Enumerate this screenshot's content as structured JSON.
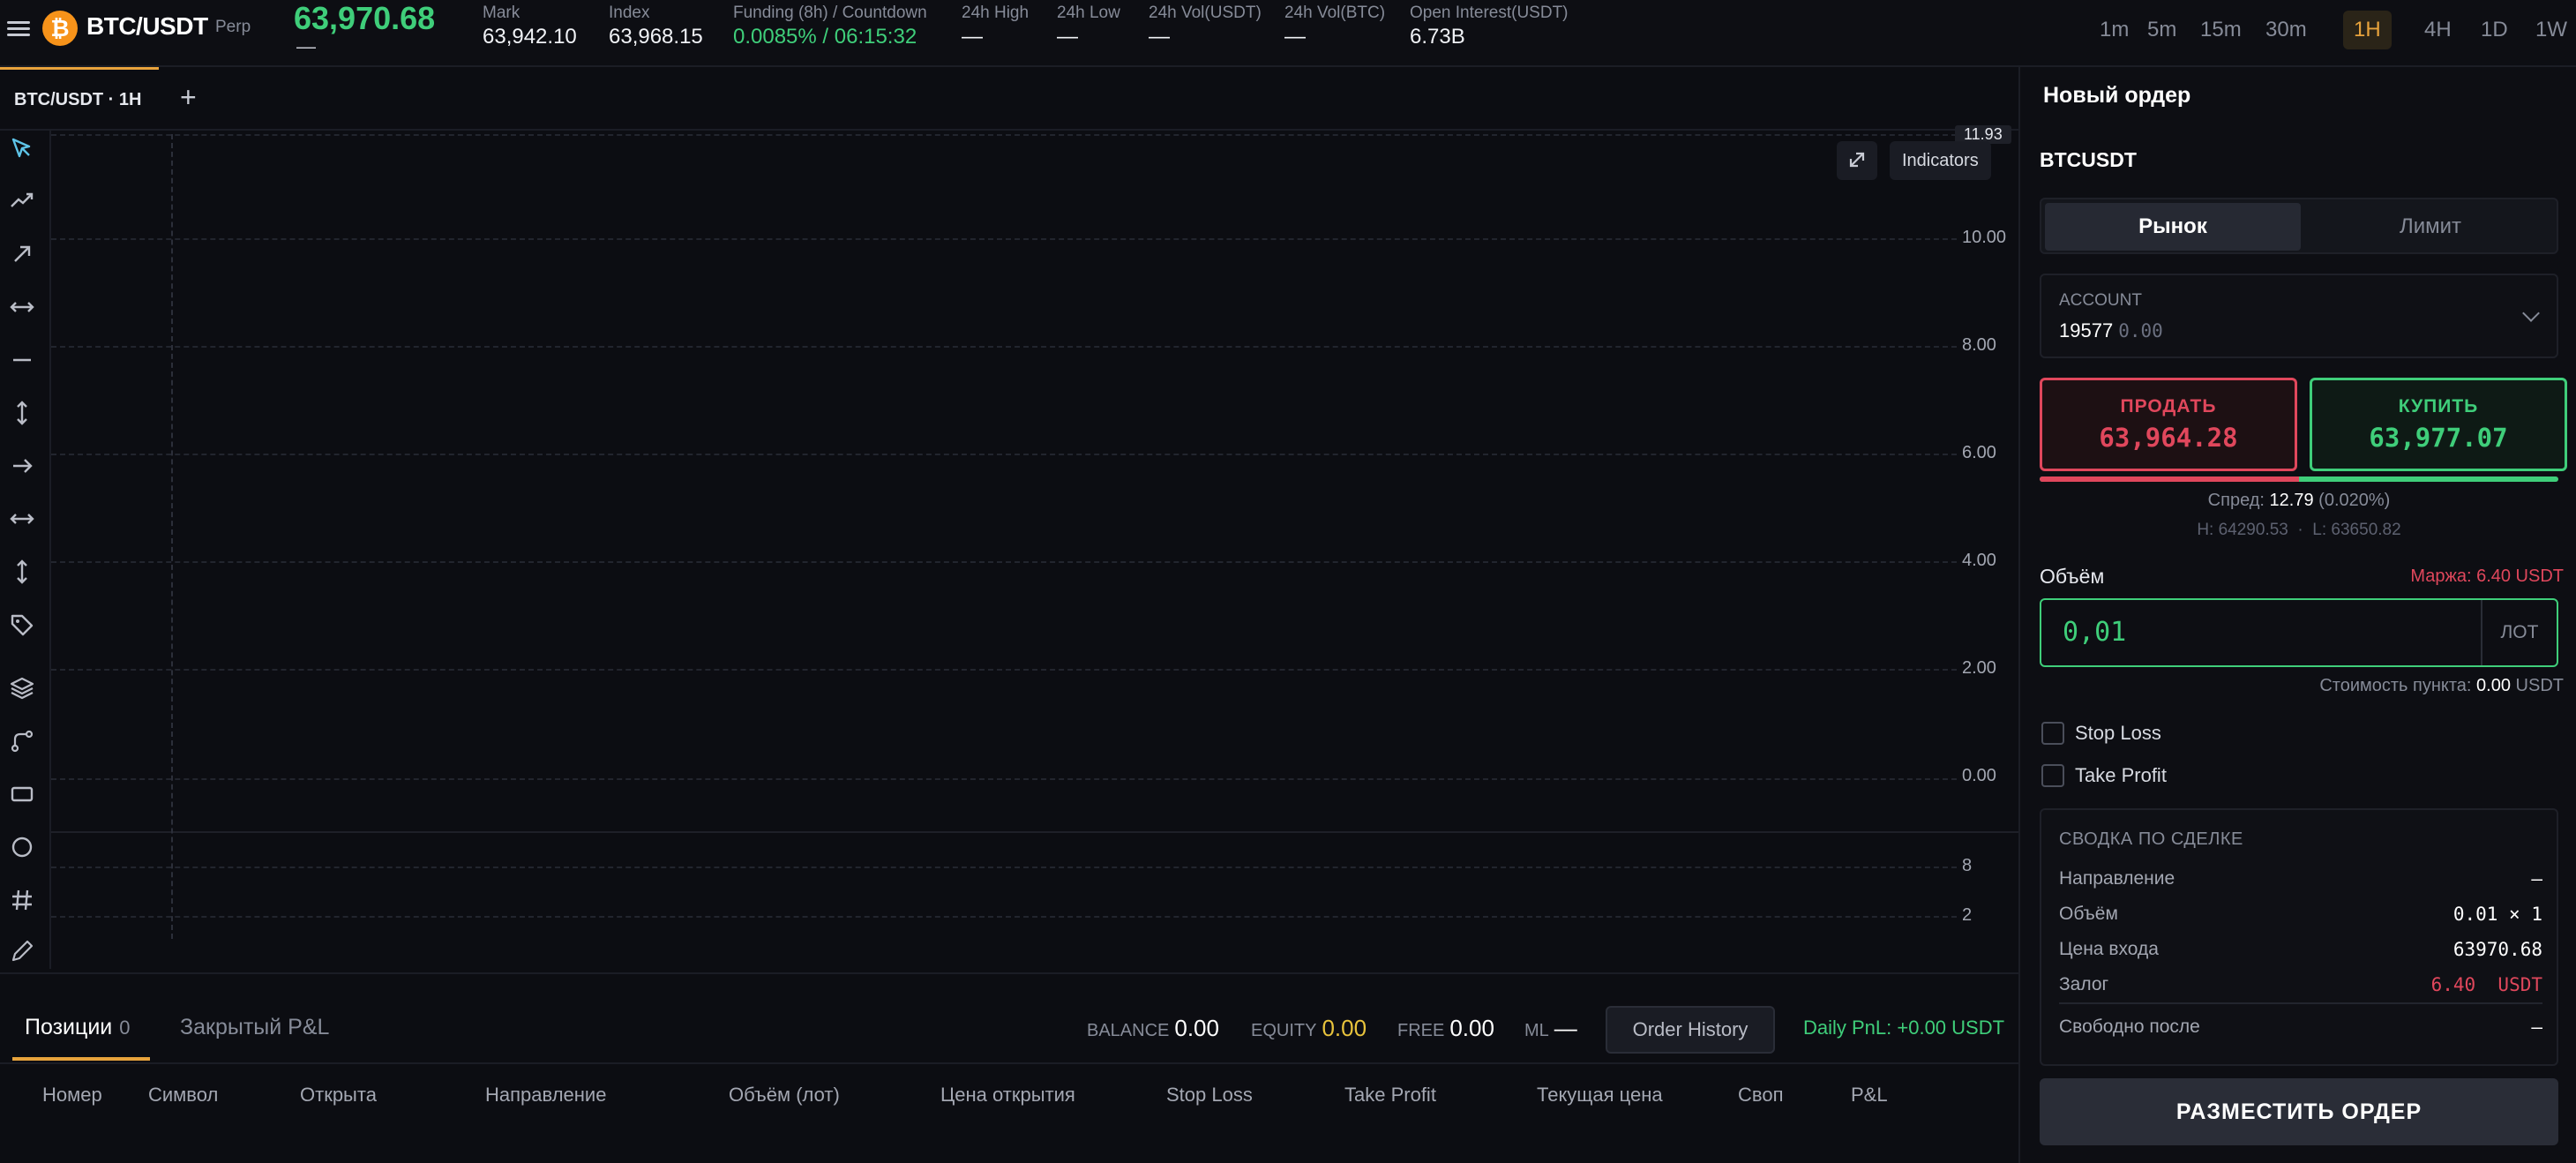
{
  "header": {
    "symbol": "BTC/USDT",
    "logo_letter": "₿",
    "contract": "Perp",
    "last_price": "63,970.68",
    "last_change": "—",
    "stats": [
      {
        "label": "Mark",
        "value": "63,942.10"
      },
      {
        "label": "Index",
        "value": "63,968.15"
      },
      {
        "label": "Funding (8h) / Countdown",
        "value": "0.0085% / 06:15:32"
      },
      {
        "label": "24h High",
        "value": "—"
      },
      {
        "label": "24h Low",
        "value": "—"
      },
      {
        "label": "24h Vol(USDT)",
        "value": "—"
      },
      {
        "label": "24h Vol(BTC)",
        "value": "—"
      },
      {
        "label": "Open Interest(USDT)",
        "value": "6.73B"
      }
    ],
    "timeframes": [
      "1m",
      "5m",
      "15m",
      "30m",
      "1H",
      "4H",
      "1D",
      "1W"
    ],
    "active_timeframe": "1H"
  },
  "chart": {
    "tab_label": "BTC/USDT · 1H",
    "add_tab": "+",
    "indicators_label": "Indicators",
    "current_badge": "11.93",
    "y_ticks": [
      "10.00",
      "8.00",
      "6.00",
      "4.00",
      "2.00",
      "0.00"
    ],
    "sub_ticks": [
      "8",
      "2"
    ]
  },
  "toolbar": {
    "tools": [
      "cursor-icon",
      "trend-line-icon",
      "arrow-ray-icon",
      "horizontal-ray-icon",
      "horizontal-line-icon",
      "vertical-line-icon",
      "arrow-right-icon",
      "width-arrow-icon",
      "height-arrow-icon",
      "price-tag-icon",
      "layers-icon",
      "path-icon",
      "rectangle-icon",
      "circle-icon",
      "grid-icon",
      "pencil-icon"
    ]
  },
  "bottom": {
    "tab_positions": "Позиции",
    "positions_count": "0",
    "tab_closed": "Закрытый P&L",
    "balance_label": "BALANCE",
    "balance": "0.00",
    "equity_label": "EQUITY",
    "equity": "0.00",
    "free_label": "FREE",
    "free": "0.00",
    "ml_label": "ML",
    "ml": "—",
    "order_history": "Order History",
    "daily_pnl": "Daily PnL: +0.00 USDT",
    "columns": [
      "Номер",
      "Символ",
      "Открыта",
      "Направление",
      "Объём (лот)",
      "Цена открытия",
      "Stop Loss",
      "Take Profit",
      "Текущая цена",
      "Своп",
      "P&L"
    ]
  },
  "order": {
    "title": "Новый ордер",
    "symbol": "BTCUSDT",
    "type_market": "Рынок",
    "type_limit": "Лимит",
    "account_label": "ACCOUNT",
    "account_id": "19577",
    "account_balance": "0.00",
    "sell_label": "ПРОДАТЬ",
    "sell_price": "63,964.28",
    "buy_label": "КУПИТЬ",
    "buy_price": "63,977.07",
    "sell_buy_ratio": 0.5,
    "spread_label": "Спред:",
    "spread_value": "12.79",
    "spread_pct": "(0.020%)",
    "high_low": "H: 64290.53  ·  L: 63650.82",
    "volume_label": "Объём",
    "margin": "Маржа: 6.40 USDT",
    "volume_value": "0,01",
    "volume_unit": "ЛОТ",
    "point_cost_label": "Стоимость пункта:",
    "point_cost_value": "0.00",
    "point_cost_unit": "USDT",
    "stop_loss": "Stop Loss",
    "take_profit": "Take Profit",
    "summary_title": "СВОДКА ПО СДЕЛКЕ",
    "summary": [
      {
        "label": "Направление",
        "value": "—"
      },
      {
        "label": "Объём",
        "value": "0.01 × 1"
      },
      {
        "label": "Цена входа",
        "value": "63970.68"
      },
      {
        "label": "Залог",
        "value": "6.40  USDT"
      },
      {
        "label": "Свободно после",
        "value": "—"
      }
    ],
    "place_order": "РАЗМЕСТИТЬ ОРДЕР"
  }
}
